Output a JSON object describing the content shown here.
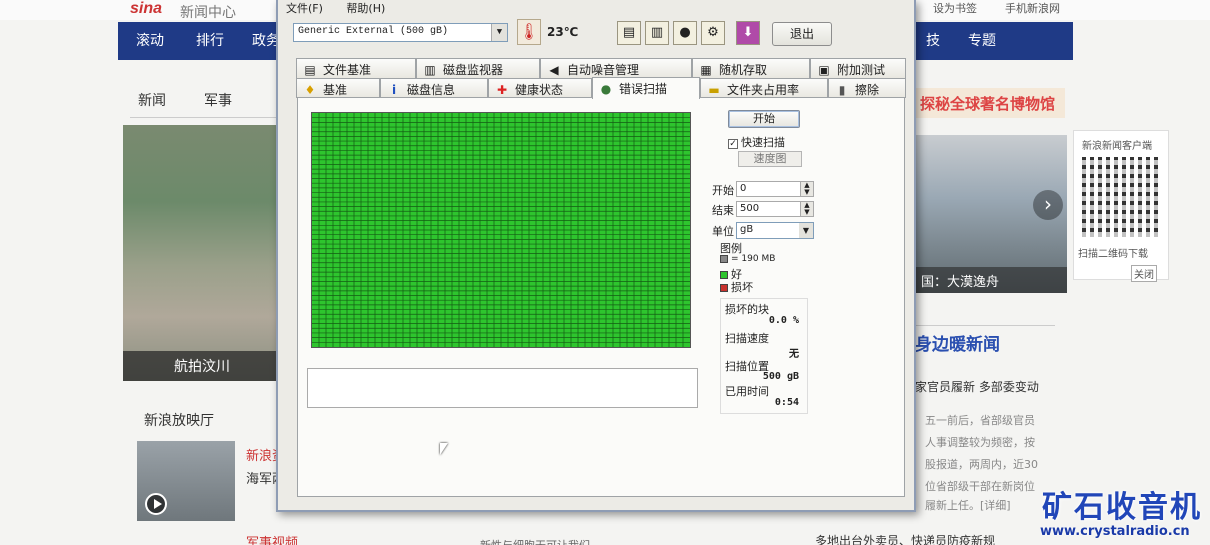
{
  "background_page": {
    "logo": "sina",
    "logo_rest": "新闻中心",
    "top_links": [
      "设为书签",
      "手机新浪网"
    ],
    "nav": [
      "滚动",
      "排行",
      "政务",
      "技",
      "专题"
    ],
    "tabs": [
      "新闻",
      "军事"
    ],
    "photo_caption": "航拍汶川",
    "section_title": "新浪放映厅",
    "video_items": [
      "新浪资",
      "海军两",
      "军事视频"
    ],
    "right_banner": "探秘全球著名博物馆",
    "photo2_caption": "国：大漠逸舟",
    "qr_title": "新浪新闻客户端",
    "qr_caption": "扫描二维码下载",
    "qr_close": "关闭",
    "hot_title": "身边暖新闻",
    "news": [
      "家官员履新 多部委变动",
      "五一前后，省部级官员",
      "人事调整较为频密，按",
      "股报道，两周内，近30",
      "位省部级干部在新岗位",
      "履新上任。[详细]",
      "多地出台外卖员、快递员防疫新规"
    ],
    "bottom_news": "新性与细胞无可让我们……"
  },
  "watermark": {
    "title": "矿石收音机",
    "url": "www.crystalradio.cn"
  },
  "app": {
    "menu": [
      "文件(F)",
      "帮助(H)"
    ],
    "drive": "Generic External (500 gB)",
    "temperature": "23℃",
    "exit_label": "退出",
    "tabs_row1": [
      {
        "label": "文件基准",
        "icon": "file-benchmark-icon",
        "glyph": "▤"
      },
      {
        "label": "磁盘监视器",
        "icon": "disk-monitor-icon",
        "glyph": "▥"
      },
      {
        "label": "自动噪音管理",
        "icon": "speaker-icon",
        "glyph": "◀"
      },
      {
        "label": "随机存取",
        "icon": "random-access-icon",
        "glyph": "▦"
      },
      {
        "label": "附加测试",
        "icon": "extra-tests-icon",
        "glyph": "▣"
      }
    ],
    "tabs_row2": [
      {
        "label": "基准",
        "icon": "lightbulb-icon",
        "glyph": "♦"
      },
      {
        "label": "磁盘信息",
        "icon": "info-icon",
        "glyph": "i"
      },
      {
        "label": "健康状态",
        "icon": "health-cross-icon",
        "glyph": "✚"
      },
      {
        "label": "错误扫描",
        "icon": "magnifier-icon",
        "glyph": "●"
      },
      {
        "label": "文件夹占用率",
        "icon": "folder-icon",
        "glyph": "▬"
      },
      {
        "label": "擦除",
        "icon": "trash-icon",
        "glyph": "▮"
      }
    ],
    "active_tab": "错误扫描",
    "scan": {
      "start_button": "开始",
      "quick_scan_label": "快速扫描",
      "quick_scan_checked": true,
      "speed_map_button": "速度图",
      "start_label": "开始",
      "start_value": "0",
      "end_label": "结束",
      "end_value": "500",
      "unit_label": "单位",
      "unit_value": "gB",
      "legend_title": "图例",
      "legend_block": "= 190 MB",
      "legend_good": "好",
      "legend_bad": "损坏",
      "damaged_label": "损坏的块",
      "damaged_value": "0.0 %",
      "speed_label": "扫描速度",
      "speed_value": "无",
      "position_label": "扫描位置",
      "position_value": "500 gB",
      "elapsed_label": "已用时间",
      "elapsed_value": "0:54",
      "grid_cols": 54,
      "grid_rows": 50,
      "grid_color": "#2ec52e",
      "bad_color": "#c8322d",
      "block_color": "#888888"
    }
  }
}
